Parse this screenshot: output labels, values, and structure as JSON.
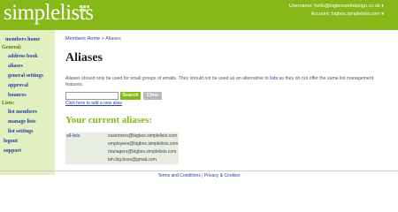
{
  "header": {
    "logo": "simplelists",
    "username_label": "Username: hello@bigboxwebdesign.co.uk ▾",
    "account_label": "Account: bigbox.simplelists.com ▾",
    "brand_color": "#86b81a"
  },
  "sidebar": {
    "members_home": "members home",
    "general_heading": "General:",
    "address_book": "address book",
    "aliases": "aliases",
    "general_settings": "general settings",
    "approval": "approval",
    "bounces": "bounces",
    "lists_heading": "Lists:",
    "list_members": "list members",
    "manage_lists": "manage lists",
    "list_settings": "list settings",
    "logout": "logout",
    "support": "support"
  },
  "breadcrumb": {
    "home": "Members Home",
    "separator": " > ",
    "current": "Aliases"
  },
  "page": {
    "title": "Aliases",
    "description_before": "Aliases should only be used for small groups of emails. They should not be used as an alternative to ",
    "description_link": "lists",
    "description_after": " as they do not offer the same list management features.",
    "search_value": "",
    "search_button": "Search",
    "clear_button": "Clear",
    "add_link": "Click here to add a new alias",
    "section_title": "Your current aliases:"
  },
  "aliases": [
    {
      "name": "all-lists",
      "emails": [
        "customers@bigbox.simplelists.com",
        "employees@bigbox.simplelists.com",
        "managers@bigbox.simplelists.com",
        "teh.big.boss@gmail.com"
      ]
    }
  ],
  "footer": {
    "terms": "Terms and Conditions",
    "separator": " | ",
    "privacy": "Privacy & Cookies"
  }
}
